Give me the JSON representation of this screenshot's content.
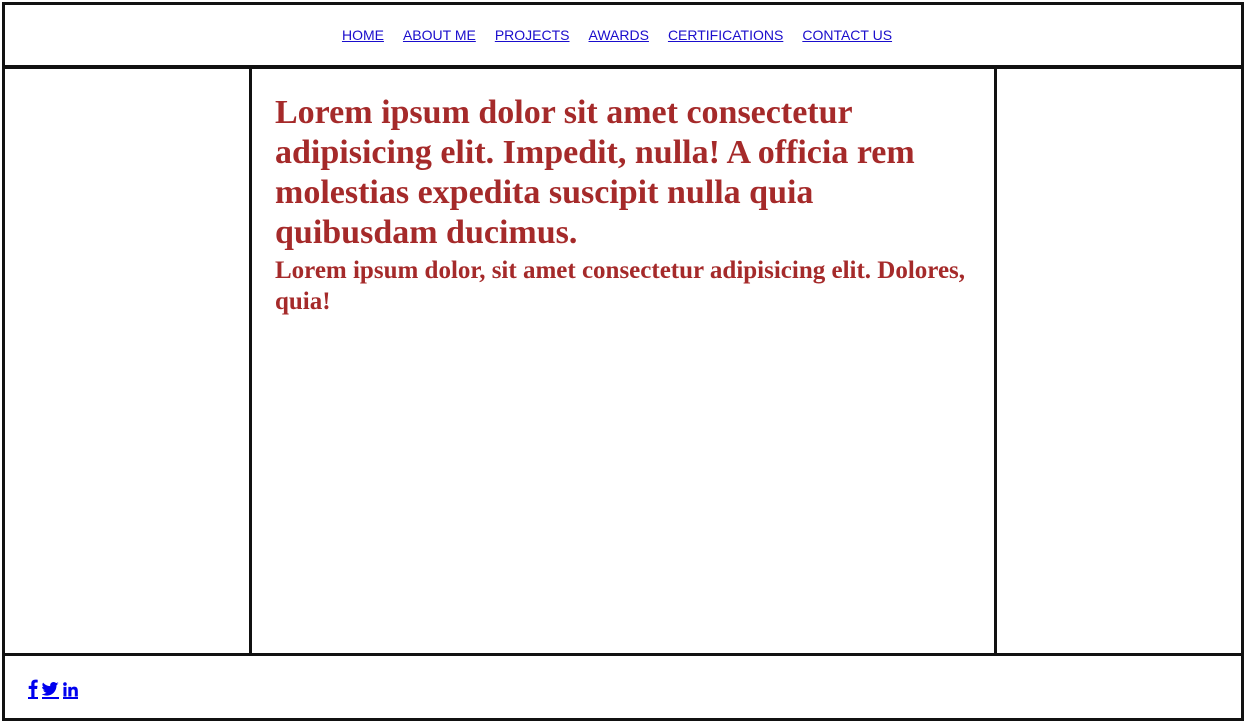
{
  "nav": {
    "items": [
      {
        "label": "HOME"
      },
      {
        "label": "ABOUT ME"
      },
      {
        "label": "PROJECTS"
      },
      {
        "label": "AWARDS"
      },
      {
        "label": "CERTIFICATIONS"
      },
      {
        "label": "CONTACT US"
      }
    ]
  },
  "main": {
    "heading": "Lorem ipsum dolor sit amet consectetur adipisicing elit. Impedit, nulla! A officia rem molestias expedita suscipit nulla quia quibusdam ducimus.",
    "subheading": "Lorem ipsum dolor, sit amet consectetur adipisicing elit. Dolores, quia!"
  },
  "footer": {
    "social": [
      {
        "icon": "facebook-icon"
      },
      {
        "icon": "twitter-icon"
      },
      {
        "icon": "linkedin-icon"
      }
    ]
  },
  "colors": {
    "heading": "#a52a2a",
    "link": "#1a0dcc",
    "border": "#111111"
  }
}
